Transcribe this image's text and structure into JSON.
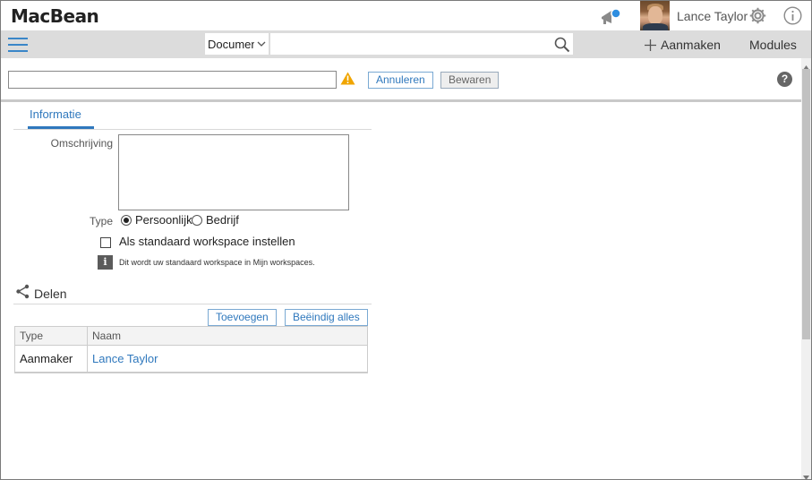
{
  "app": {
    "logo": "MacBean",
    "user_name": "Lance Taylor"
  },
  "nav": {
    "search_type": "Documenten",
    "search_value": "",
    "create_label": "Aanmaken",
    "modules_label": "Modules"
  },
  "editbar": {
    "name_value": "",
    "cancel_label": "Annuleren",
    "save_label": "Bewaren",
    "help_glyph": "?"
  },
  "tabs": [
    {
      "label": "Informatie",
      "active": true
    }
  ],
  "form": {
    "description_label": "Omschrijving",
    "description_value": "",
    "type_label": "Type",
    "type_options": [
      {
        "label": "Persoonlijk",
        "checked": true
      },
      {
        "label": "Bedrijf",
        "checked": false
      }
    ],
    "default_checkbox_label": "Als standaard workspace instellen",
    "default_checked": false,
    "info_glyph": "i",
    "hint_text": "Dit wordt uw standaard workspace in Mijn workspaces."
  },
  "share": {
    "title": "Delen",
    "add_label": "Toevoegen",
    "end_all_label": "Beëindig alles",
    "columns": [
      "Type",
      "Naam"
    ],
    "rows": [
      {
        "type": "Aanmaker",
        "name": "Lance Taylor"
      }
    ]
  },
  "colors": {
    "accent": "#2f78bd",
    "navbar_bg": "#dcdcdc",
    "warning": "#f0a500",
    "notification_dot": "#2f8ee0"
  },
  "icons": {
    "notification": "bullhorn-icon",
    "settings": "gear-icon",
    "info": "info-icon",
    "menu": "hamburger-icon",
    "search": "search-icon",
    "create": "plus-icon",
    "warning": "warning-icon",
    "help": "help-icon",
    "share": "share-icon"
  }
}
